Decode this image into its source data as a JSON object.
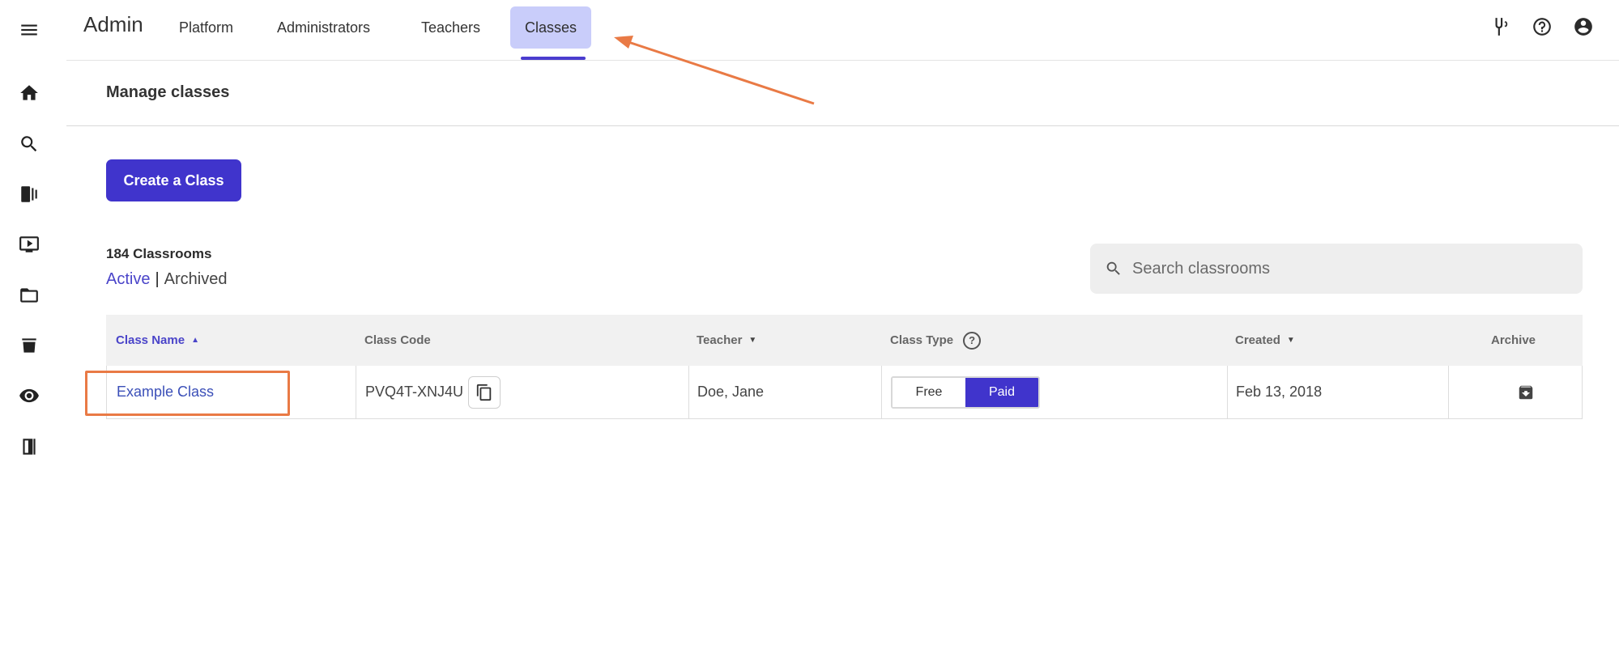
{
  "header": {
    "brand": "Admin",
    "tabs": [
      {
        "label": "Platform"
      },
      {
        "label": "Administrators"
      },
      {
        "label": "Teachers"
      },
      {
        "label": "Classes",
        "active": true
      }
    ],
    "icons": [
      "tuning-fork-icon",
      "help-circle-icon",
      "account-circle-icon"
    ]
  },
  "sidebar": {
    "icons": [
      "menu-icon",
      "home-icon",
      "search-icon",
      "library-icon",
      "presentation-icon",
      "folder-icon",
      "teacher-icon",
      "eye-icon",
      "exit-door-icon"
    ]
  },
  "page": {
    "title": "Manage classes",
    "create_button": "Create a Class",
    "count_label": "184 Classrooms",
    "filter_active": "Active",
    "filter_separator": "|",
    "filter_archived": "Archived",
    "search_placeholder": "Search classrooms"
  },
  "table": {
    "columns": {
      "name": "Class Name",
      "code": "Class Code",
      "teacher": "Teacher",
      "type": "Class Type",
      "type_help": "?",
      "created": "Created",
      "archive": "Archive"
    },
    "sort": {
      "column": "Class Name",
      "direction": "ascending"
    },
    "rows": [
      {
        "name": "Example Class",
        "code": "PVQ4T-XNJ4U",
        "teacher": "Doe, Jane",
        "type_options": [
          "Free",
          "Paid"
        ],
        "type_selected": "Paid",
        "created": "Feb 13, 2018"
      }
    ]
  },
  "annotation": {
    "color": "#e97a45"
  },
  "colors": {
    "accent": "#4034cc",
    "active_tab_bg": "#c9cdfa",
    "link": "#4a44c9"
  }
}
